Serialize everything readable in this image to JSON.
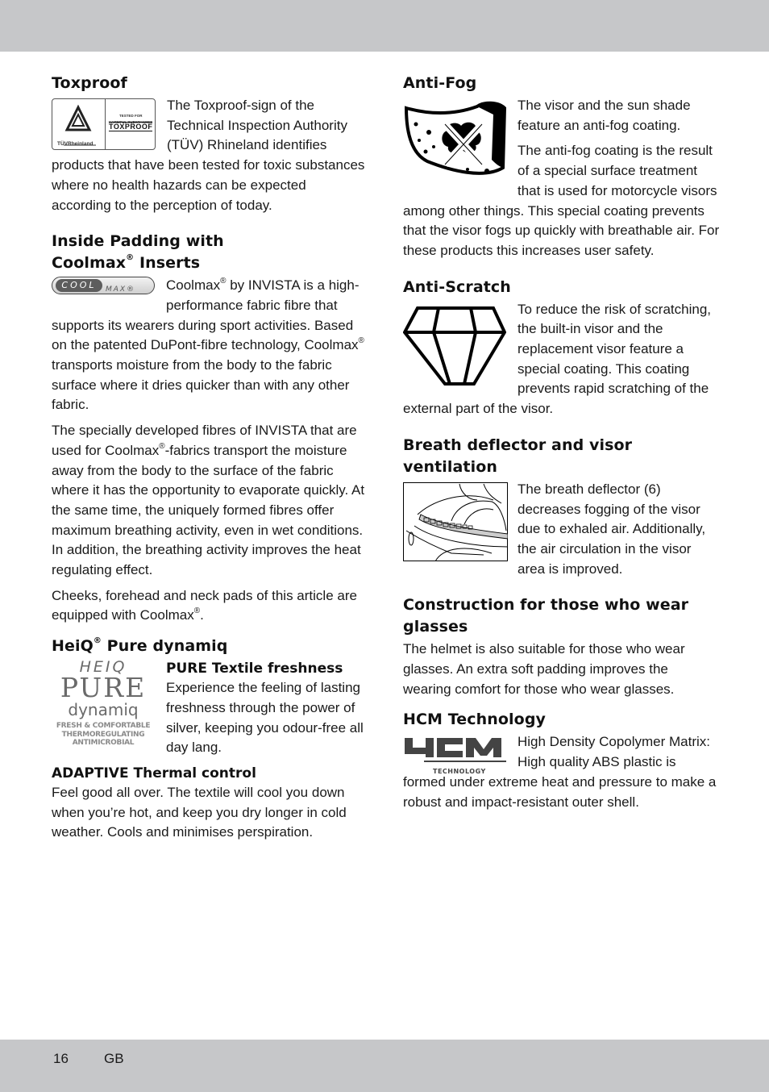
{
  "page": {
    "number": "16",
    "language": "GB"
  },
  "left_column": {
    "toxproof": {
      "heading": "Toxproof",
      "logo": {
        "brand": "TÜVRheinland",
        "tested": "TESTED FOR",
        "harmful": "HARMFUL SUBSTANCES",
        "mark": "TOXPROOF"
      },
      "text": "The Toxproof-sign of the Technical Inspection Authority (TÜV) Rhineland identifies products that have been tested for toxic substances where no health hazards can be expected according to the perception of today."
    },
    "coolmax": {
      "heading_line1": "Inside Padding with",
      "heading_line2_a": "Coolmax",
      "heading_line2_b": " Inserts",
      "reg": "®",
      "logo": {
        "cool": "COOL",
        "max": "MAX®"
      },
      "p1_a": "Coolmax",
      "p1_b": " by INVISTA is a high-performance fabric fibre that supports its wearers during sport activities. Based on the patented DuPont-fibre technology, Coolmax",
      "p1_c": " transports moisture from the body to the fabric surface where it dries quicker than with any other fabric.",
      "p2_a": "The specially developed fibres of INVISTA that are used for Coolmax",
      "p2_b": "-fabrics transport the moisture away from the body to the surface of the fabric where it has the opportunity to evaporate quickly. At the same time, the uniquely formed fibres offer maximum breathing activity, even in wet conditions. In addition, the breathing activity improves the heat regulating effect.",
      "p3_a": "Cheeks, forehead and neck pads of this article are equipped with Coolmax",
      "p3_b": "."
    },
    "heiq": {
      "heading_a": "HeiQ",
      "heading_b": " Pure dynamiq",
      "reg": "®",
      "logo": {
        "line1": "HEIQ",
        "line2": "PURE",
        "line3": "dynamiq",
        "line4": "FRESH & COMFORTABLE",
        "line5": "THERMOREGULATING",
        "line6": "ANTIMICROBIAL"
      },
      "sub1": "PURE Textile freshness",
      "text1": "Experience the feeling of lasting freshness through the power of silver, keeping you odour-free all day lang.",
      "sub2": "ADAPTIVE Thermal control",
      "text2": "Feel good all over. The textile will cool you down when you’re hot, and keep you dry longer in cold weather. Cools and minimises perspiration."
    }
  },
  "right_column": {
    "antifog": {
      "heading": "Anti-Fog",
      "icon": "visor-fog-crossed-icon",
      "p1": "The visor and the sun shade feature an anti-fog coating.",
      "p2": "The anti-fog coating is the result of a special surface treatment that is used for motorcycle visors among other things. This special coating prevents that the visor fogs up quickly with breathable air. For these products this increases user safety."
    },
    "antiscratch": {
      "heading": "Anti-Scratch",
      "icon": "diamond-icon",
      "text": "To reduce the risk of scratching, the built-in visor and the replacement visor feature a special coating. This coating prevents rapid scratching of the external part of the visor."
    },
    "breath": {
      "heading": "Breath deflector and visor ventilation",
      "icon": "helmet-breath-deflector-illustration",
      "text": "The breath deflector (6) decreases fogging of the visor due to exhaled air. Additionally, the air circulation in the visor area is improved."
    },
    "glasses": {
      "heading": "Construction for those who wear glasses",
      "text": "The helmet is also suitable for those who wear glasses. An extra soft padding improves the wearing comfort for those who wear glasses."
    },
    "hcm": {
      "heading": "HCM Technology",
      "logo": {
        "big": "HCM",
        "small": "TECHNOLOGY"
      },
      "text": "High Density Copolymer Matrix: High quality ABS plastic is formed under extreme heat and pressure to make a robust and impact-resistant outer shell."
    }
  }
}
